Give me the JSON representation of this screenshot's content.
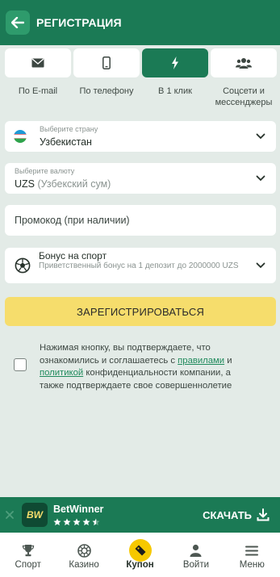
{
  "header": {
    "title": "РЕГИСТРАЦИЯ"
  },
  "tabs": [
    {
      "label": "По E-mail",
      "icon": "envelope-icon",
      "active": false
    },
    {
      "label": "По телефону",
      "icon": "phone-icon",
      "active": false
    },
    {
      "label": "В 1 клик",
      "icon": "lightning-icon",
      "active": true
    },
    {
      "label": "Соцсети и мессенджеры",
      "icon": "users-icon",
      "active": false
    }
  ],
  "form": {
    "country": {
      "label": "Выберите страну",
      "value": "Узбекистан",
      "icon": "uzbekistan-flag-icon"
    },
    "currency": {
      "label": "Выберите валюту",
      "code": "UZS",
      "name": "(Узбекский сум)"
    },
    "promo": {
      "placeholder": "Промокод (при наличии)"
    },
    "bonus": {
      "title": "Бонус на спорт",
      "description": "Приветственный бонус на 1 депозит до 2000000 UZS",
      "icon": "soccer-ball-icon"
    },
    "register_label": "ЗАРЕГИСТРИРОВАТЬСЯ"
  },
  "agreement": {
    "text1": "Нажимая кнопку, вы подтверждаете, что ознакомились и соглашаетесь с ",
    "link1": "правилами",
    "text2": " и ",
    "link2": "политикой",
    "text3": " конфиденциальности компании, а также подтверждаете свое совершеннолетие",
    "checked": false
  },
  "banner": {
    "app_name": "BetWinner",
    "logo_text": "BW",
    "rating": 4.5,
    "download_label": "СКАЧАТЬ"
  },
  "bottom_nav": [
    {
      "label": "Спорт",
      "icon": "trophy-icon"
    },
    {
      "label": "Казино",
      "icon": "roulette-icon"
    },
    {
      "label": "Купон",
      "icon": "coupon-icon"
    },
    {
      "label": "Войти",
      "icon": "user-icon"
    },
    {
      "label": "Меню",
      "icon": "menu-icon"
    }
  ],
  "colors": {
    "primary": "#1b7a55",
    "accent": "#f6dd6c",
    "background": "#e3ebe7"
  }
}
